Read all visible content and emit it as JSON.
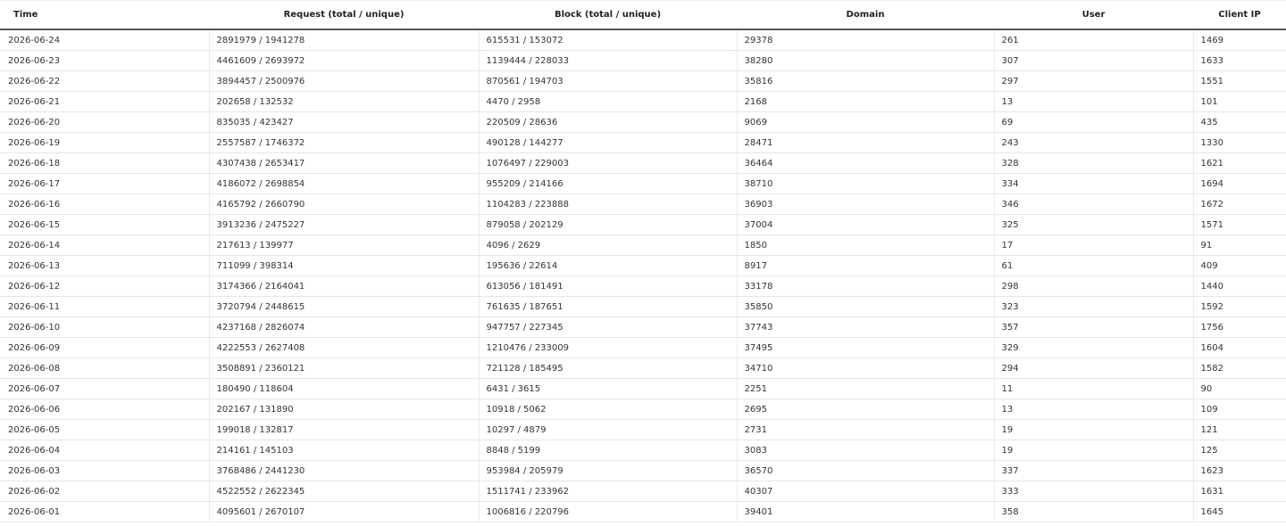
{
  "table": {
    "columns": [
      "Time",
      "Request (total / unique)",
      "Block (total / unique)",
      "Domain",
      "User",
      "Client IP"
    ],
    "rows": [
      [
        "2026-06-24",
        "2891979 / 1941278",
        "615531 / 153072",
        "29378",
        "261",
        "1469"
      ],
      [
        "2026-06-23",
        "4461609 / 2693972",
        "1139444 / 228033",
        "38280",
        "307",
        "1633"
      ],
      [
        "2026-06-22",
        "3894457 / 2500976",
        "870561 / 194703",
        "35816",
        "297",
        "1551"
      ],
      [
        "2026-06-21",
        "202658 / 132532",
        "4470 / 2958",
        "2168",
        "13",
        "101"
      ],
      [
        "2026-06-20",
        "835035 / 423427",
        "220509 / 28636",
        "9069",
        "69",
        "435"
      ],
      [
        "2026-06-19",
        "2557587 / 1746372",
        "490128 / 144277",
        "28471",
        "243",
        "1330"
      ],
      [
        "2026-06-18",
        "4307438 / 2653417",
        "1076497 / 229003",
        "36464",
        "328",
        "1621"
      ],
      [
        "2026-06-17",
        "4186072 / 2698854",
        "955209 / 214166",
        "38710",
        "334",
        "1694"
      ],
      [
        "2026-06-16",
        "4165792 / 2660790",
        "1104283 / 223888",
        "36903",
        "346",
        "1672"
      ],
      [
        "2026-06-15",
        "3913236 / 2475227",
        "879058 / 202129",
        "37004",
        "325",
        "1571"
      ],
      [
        "2026-06-14",
        "217613 / 139977",
        "4096 / 2629",
        "1850",
        "17",
        "91"
      ],
      [
        "2026-06-13",
        "711099 / 398314",
        "195636 / 22614",
        "8917",
        "61",
        "409"
      ],
      [
        "2026-06-12",
        "3174366 / 2164041",
        "613056 / 181491",
        "33178",
        "298",
        "1440"
      ],
      [
        "2026-06-11",
        "3720794 / 2448615",
        "761635 / 187651",
        "35850",
        "323",
        "1592"
      ],
      [
        "2026-06-10",
        "4237168 / 2826074",
        "947757 / 227345",
        "37743",
        "357",
        "1756"
      ],
      [
        "2026-06-09",
        "4222553 / 2627408",
        "1210476 / 233009",
        "37495",
        "329",
        "1604"
      ],
      [
        "2026-06-08",
        "3508891 / 2360121",
        "721128 / 185495",
        "34710",
        "294",
        "1582"
      ],
      [
        "2026-06-07",
        "180490 / 118604",
        "6431 / 3615",
        "2251",
        "11",
        "90"
      ],
      [
        "2026-06-06",
        "202167 / 131890",
        "10918 / 5062",
        "2695",
        "13",
        "109"
      ],
      [
        "2026-06-05",
        "199018 / 132817",
        "10297 / 4879",
        "2731",
        "19",
        "121"
      ],
      [
        "2026-06-04",
        "214161 / 145103",
        "8848 / 5199",
        "3083",
        "19",
        "125"
      ],
      [
        "2026-06-03",
        "3768486 / 2441230",
        "953984 / 205979",
        "36570",
        "337",
        "1623"
      ],
      [
        "2026-06-02",
        "4522552 / 2622345",
        "1511741 / 233962",
        "40307",
        "333",
        "1631"
      ],
      [
        "2026-06-01",
        "4095601 / 2670107",
        "1006816 / 220796",
        "39401",
        "358",
        "1645"
      ]
    ]
  }
}
